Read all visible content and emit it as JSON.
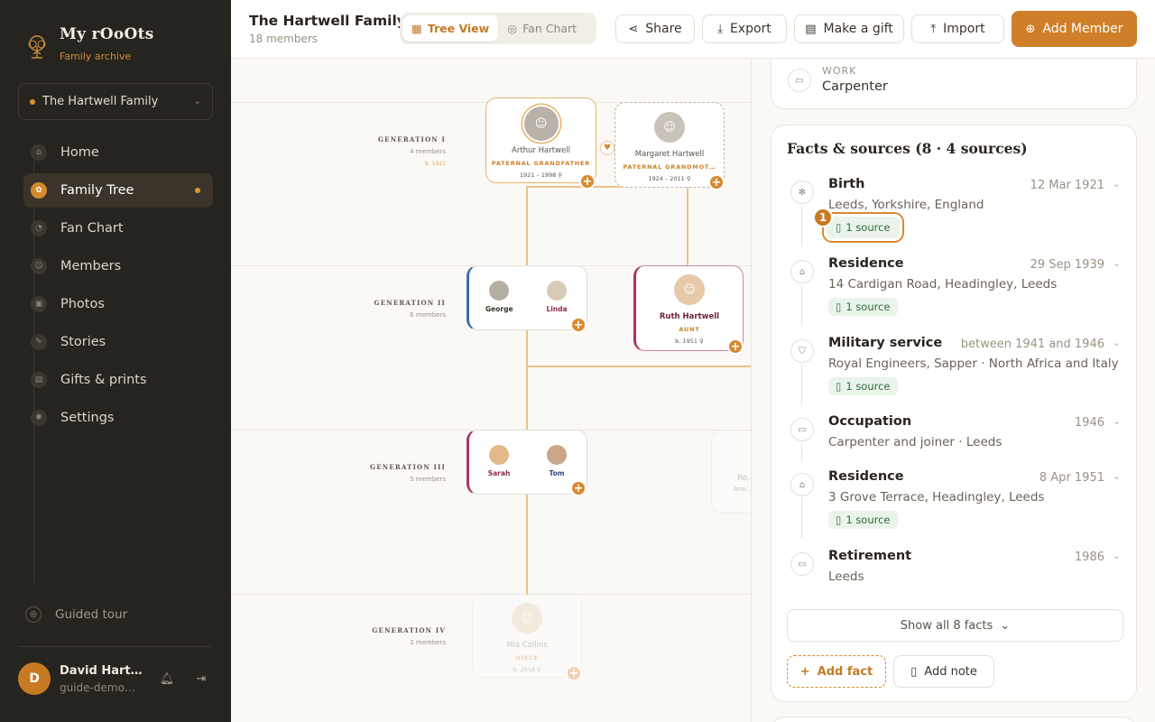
{
  "brand": {
    "name": "My rOoOts",
    "subtitle": "Family archive"
  },
  "family_selector": {
    "value": "The Hartwell Family"
  },
  "nav": [
    {
      "label": "Home",
      "icon": "home-icon"
    },
    {
      "label": "Family Tree",
      "icon": "tree-icon",
      "active": true
    },
    {
      "label": "Fan Chart",
      "icon": "fan-chart-icon"
    },
    {
      "label": "Members",
      "icon": "members-icon"
    },
    {
      "label": "Photos",
      "icon": "photos-icon"
    },
    {
      "label": "Stories",
      "icon": "stories-icon"
    },
    {
      "label": "Gifts & prints",
      "icon": "gift-icon"
    },
    {
      "label": "Settings",
      "icon": "settings-icon"
    }
  ],
  "guided_tour": "Guided tour",
  "user": {
    "initial": "D",
    "name": "David Hartwell",
    "email": "guide-demo@myroots.app"
  },
  "header": {
    "title": "The Hartwell Family",
    "subtitle": "18 members",
    "tabs": [
      {
        "label": "Tree View",
        "active": true
      },
      {
        "label": "Fan Chart",
        "active": false
      }
    ],
    "buttons": {
      "share": "Share",
      "export": "Export",
      "gift": "Make a gift",
      "import": "Import",
      "add_member": "Add Member"
    }
  },
  "tree": {
    "generations": [
      {
        "title": "GENERATION I",
        "members": "4 members",
        "extra": "b. 1921"
      },
      {
        "title": "GENERATION II",
        "members": "6 members"
      },
      {
        "title": "GENERATION III",
        "members": "5 members"
      },
      {
        "title": "GENERATION IV",
        "members": "3 members"
      }
    ],
    "gen1": [
      {
        "name": "Arthur Hartwell",
        "role": "PATERNAL GRANDFATHER",
        "years": "1921 – 1998 ⚲"
      },
      {
        "name": "Margaret Hartwell",
        "role": "PATERNAL GRANDMOT…",
        "years": "1924 – 2011 ⚲"
      }
    ],
    "gen2_couple": [
      "George",
      "Linda"
    ],
    "gen2_single": {
      "name": "Ruth Hartwell",
      "role": "AUNT",
      "years": "b. 1951 ⚲"
    },
    "gen3_couple": [
      "Sarah",
      "Tom"
    ],
    "gen3_faded": {
      "name": "Ro…",
      "role": "Ann…"
    },
    "gen4": {
      "name": "Mia Collins",
      "role": "NIECE",
      "years": "b. 2018 ⚲"
    }
  },
  "panel": {
    "work": {
      "label": "WORK",
      "value": "Carpenter"
    },
    "facts_title": "Facts & sources (8 · 4 sources)",
    "facts": [
      {
        "type": "Birth",
        "date": "12 Mar 1921",
        "place": "Leeds, Yorkshire, England",
        "source": "1 source"
      },
      {
        "type": "Residence",
        "date": "29 Sep 1939",
        "place": "14 Cardigan Road, Headingley, Leeds",
        "source": "1 source"
      },
      {
        "type": "Military service",
        "date": "between 1941 and 1946",
        "place": "Royal Engineers, Sapper · North Africa and Italy",
        "source": "1 source"
      },
      {
        "type": "Occupation",
        "date": "1946",
        "place": "Carpenter and joiner · Leeds"
      },
      {
        "type": "Residence",
        "date": "8 Apr 1951",
        "place": "3 Grove Terrace, Headingley, Leeds",
        "source": "1 source"
      },
      {
        "type": "Retirement",
        "date": "1986",
        "place": "Leeds"
      }
    ],
    "tour_step": "1",
    "show_all": "Show all 8 facts",
    "add_fact": "Add fact",
    "add_note": "Add note"
  },
  "colors": {
    "accent": "#cf7f27",
    "sidebar": "#26241f",
    "source_bg": "#eaf4ea"
  }
}
